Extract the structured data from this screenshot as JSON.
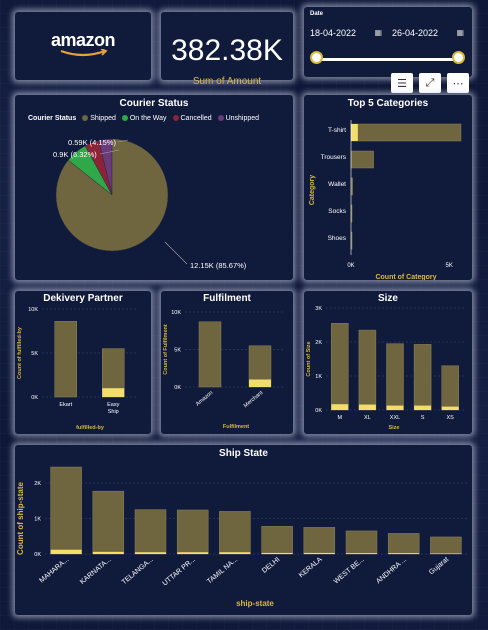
{
  "logo": {
    "text": "amazon"
  },
  "kpi": {
    "value": "382.38K",
    "label": "Sum of Amount"
  },
  "date_slicer": {
    "label": "Date",
    "start": "18-04-2022",
    "end": "26-04-2022"
  },
  "toolbar": {
    "icons": [
      "filter-icon",
      "expand-icon",
      "more-options-icon"
    ],
    "filter": "☰",
    "expand": "⤢",
    "more": "⋯"
  },
  "colors": {
    "accent": "#d8b93c",
    "bar": "#6f6640",
    "bar_stroke": "#8c8255",
    "bar_highlight": "#f2de6a",
    "background": "#0f1838",
    "card": "#101b3c"
  },
  "courier_status": {
    "title": "Courier Status",
    "legend_title": "Courier Status",
    "chart_data": {
      "type": "pie",
      "labels": [
        "Shipped",
        "On the Way",
        "Cancelled",
        "Unshipped"
      ],
      "values": [
        12.15,
        0.9,
        0.59,
        0.54
      ],
      "value_labels": [
        "12.15K (85.67%)",
        "0.9K (6.32%)",
        "0.59K (4.15%)",
        ""
      ],
      "colors": [
        "#6f6640",
        "#2fa84a",
        "#8c2337",
        "#6a3a7a"
      ]
    }
  },
  "top_categories": {
    "title": "Top 5 Categories",
    "chart_data": {
      "type": "bar",
      "orientation": "horizontal",
      "categories": [
        "T-shirt",
        "Trousers",
        "Wallet",
        "Socks",
        "Shoes"
      ],
      "values": [
        5600,
        1150,
        80,
        30,
        10
      ],
      "highlight": [
        350,
        0,
        0,
        0,
        0
      ],
      "xlabel": "Count of Category",
      "ylabel": "Category",
      "xticks": [
        "0K",
        "5K"
      ],
      "xlim": [
        0,
        5000
      ]
    }
  },
  "delivery_partner": {
    "title": "Dekivery Partner",
    "chart_data": {
      "type": "bar",
      "categories": [
        "Ekart",
        "Easy Ship"
      ],
      "values": [
        8600,
        5500
      ],
      "highlight": [
        0,
        1000
      ],
      "ylabel": "Count of fulfilled-by",
      "xlabel": "fulfilled-by",
      "yticks": [
        "10K",
        "5K",
        "0K"
      ],
      "ylim": [
        0,
        10000
      ]
    }
  },
  "fulfilment": {
    "title": "Fulfilment",
    "chart_data": {
      "type": "bar",
      "categories": [
        "Amazon",
        "Merchant"
      ],
      "values": [
        8700,
        5500
      ],
      "highlight": [
        0,
        1000
      ],
      "ylabel": "Count of Fulfilment",
      "xlabel": "Fulfilment",
      "yticks": [
        "10K",
        "5K",
        "0K"
      ],
      "ylim": [
        0,
        10000
      ]
    }
  },
  "size": {
    "title": "Size",
    "chart_data": {
      "type": "bar",
      "categories": [
        "M",
        "XL",
        "XXL",
        "S",
        "XS"
      ],
      "values": [
        2550,
        2350,
        1950,
        1930,
        1300
      ],
      "highlight": [
        170,
        160,
        130,
        130,
        100
      ],
      "ylabel": "Count of Size",
      "xlabel": "Size",
      "yticks": [
        "3K",
        "2K",
        "1K",
        "0K"
      ],
      "ylim": [
        0,
        3000
      ]
    }
  },
  "ship_state": {
    "title": "Ship State",
    "chart_data": {
      "type": "bar",
      "categories": [
        "MAHARA...",
        "KARNATA...",
        "TELANGA...",
        "UTTAR PR...",
        "TAMIL NA...",
        "DELHI",
        "KERALA",
        "WEST BE...",
        "ANDHRA ...",
        "Gujarat"
      ],
      "values": [
        2450,
        1770,
        1250,
        1240,
        1200,
        780,
        750,
        650,
        580,
        480
      ],
      "highlight": [
        120,
        60,
        50,
        50,
        50,
        30,
        30,
        25,
        25,
        15
      ],
      "ylabel": "Count of ship-state",
      "xlabel": "ship-state",
      "yticks": [
        "2K",
        "1K",
        "0K"
      ],
      "ylim": [
        0,
        2800
      ]
    }
  }
}
